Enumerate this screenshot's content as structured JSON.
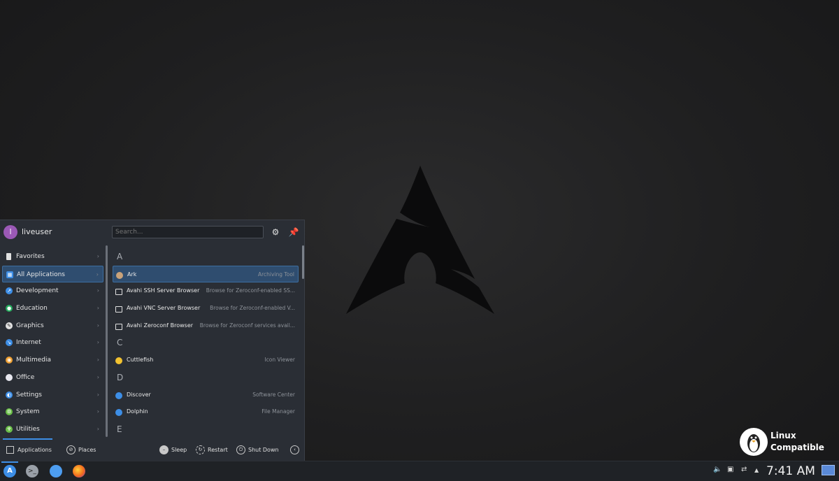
{
  "menu": {
    "user": {
      "initial": "l",
      "name": "liveuser"
    },
    "search_placeholder": "Search...",
    "categories": [
      {
        "label": "Favorites",
        "icon": "bookmark-icon",
        "color": "#e0e0e0"
      },
      {
        "label": "All Applications",
        "icon": "grid-icon",
        "color": "#3d8ee6",
        "active": true
      },
      {
        "label": "Development",
        "icon": "code-icon",
        "color": "#3d8ee6"
      },
      {
        "label": "Education",
        "icon": "education-icon",
        "color": "#27ae60"
      },
      {
        "label": "Graphics",
        "icon": "graphics-icon",
        "color": "#e0e0e0"
      },
      {
        "label": "Internet",
        "icon": "internet-icon",
        "color": "#3d8ee6"
      },
      {
        "label": "Multimedia",
        "icon": "multimedia-icon",
        "color": "#f0a030"
      },
      {
        "label": "Office",
        "icon": "office-icon",
        "color": "#e0e0e0"
      },
      {
        "label": "Settings",
        "icon": "settings-icon",
        "color": "#3d8ee6"
      },
      {
        "label": "System",
        "icon": "system-icon",
        "color": "#6cc04a"
      },
      {
        "label": "Utilities",
        "icon": "utilities-icon",
        "color": "#6cc04a"
      }
    ],
    "sections": [
      {
        "letter": "A",
        "apps": [
          {
            "name": "Ark",
            "desc": "Archiving Tool",
            "icon": "archive-icon",
            "color": "#c9a27a",
            "active": true
          },
          {
            "name": "Avahi SSH Server Browser",
            "desc": "Browse for Zeroconf-enabled SS...",
            "icon": "monitor-icon",
            "color": "#e0e0e0"
          },
          {
            "name": "Avahi VNC Server Browser",
            "desc": "Browse for Zeroconf-enabled V...",
            "icon": "monitor-icon",
            "color": "#e0e0e0"
          },
          {
            "name": "Avahi Zeroconf Browser",
            "desc": "Browse for Zeroconf services avail...",
            "icon": "monitor-icon",
            "color": "#e0e0e0"
          }
        ]
      },
      {
        "letter": "C",
        "apps": [
          {
            "name": "Cuttlefish",
            "desc": "Icon Viewer",
            "icon": "cuttlefish-icon",
            "color": "#f2c230"
          }
        ]
      },
      {
        "letter": "D",
        "apps": [
          {
            "name": "Discover",
            "desc": "Software Center",
            "icon": "discover-icon",
            "color": "#3d8ee6"
          },
          {
            "name": "Dolphin",
            "desc": "File Manager",
            "icon": "folder-icon",
            "color": "#3d8ee6"
          }
        ]
      },
      {
        "letter": "E",
        "apps": []
      }
    ],
    "footer": {
      "applications": "Applications",
      "places": "Places",
      "sleep": "Sleep",
      "restart": "Restart",
      "shutdown": "Shut Down"
    }
  },
  "taskbar": {
    "clock": "7:41 AM"
  },
  "watermark": {
    "line1": "Linux",
    "line2": "Compatible"
  }
}
